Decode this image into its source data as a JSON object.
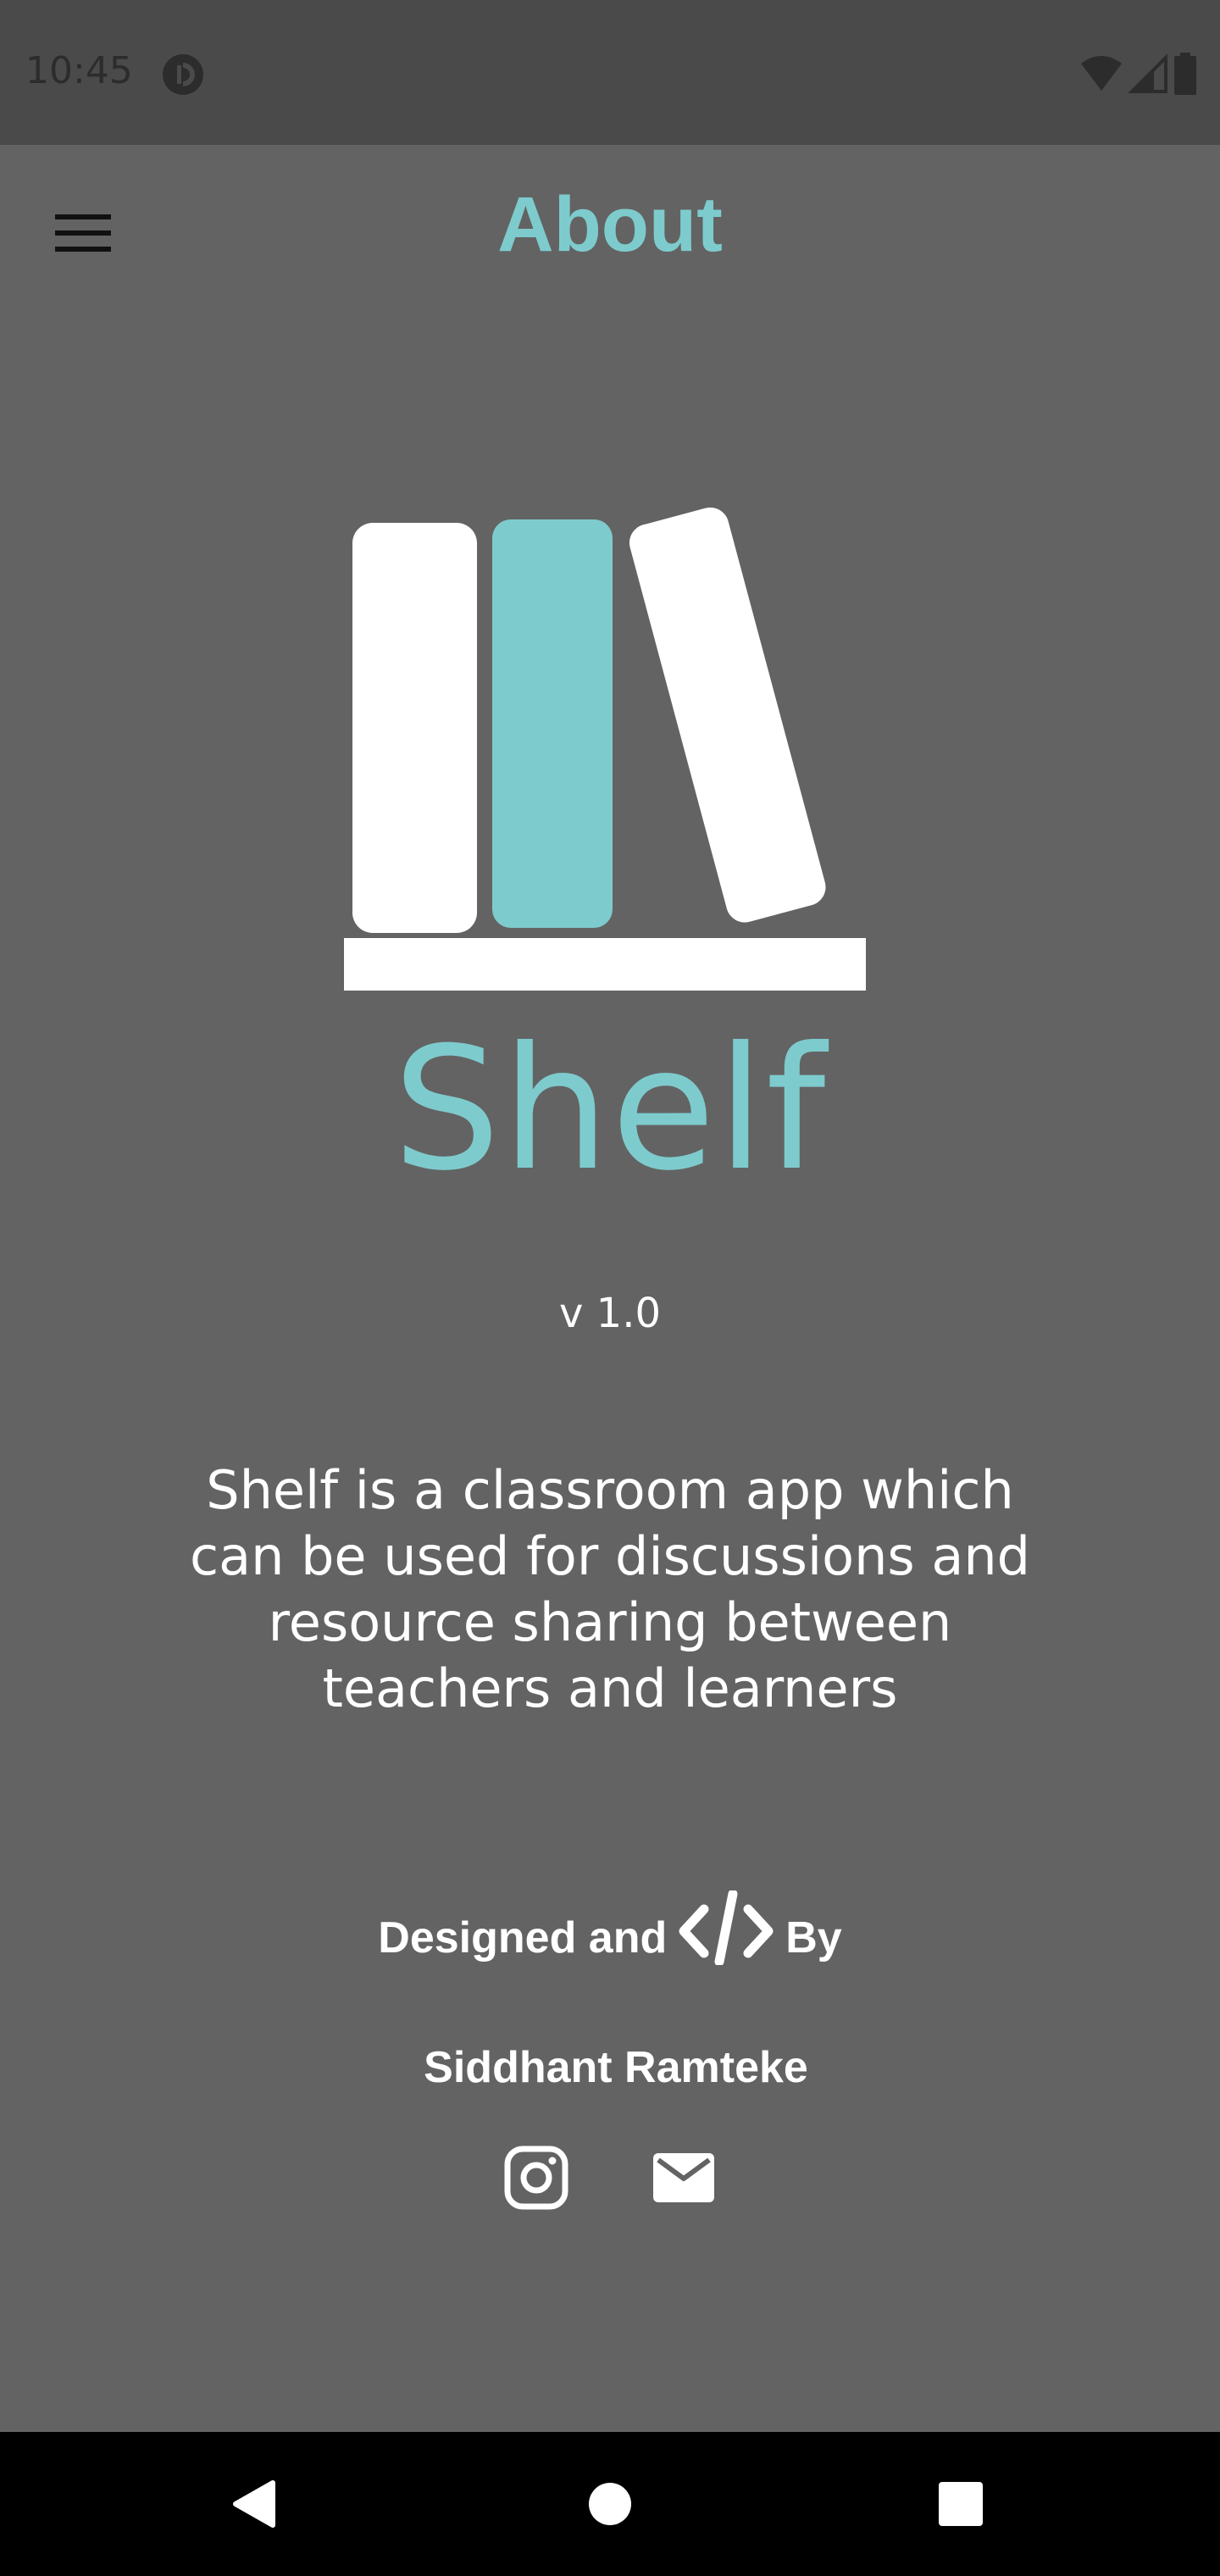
{
  "status_bar": {
    "time": "10:45",
    "app_icon": "pocket-casts-icon",
    "icons": [
      "wifi-icon",
      "signal-icon",
      "battery-icon"
    ]
  },
  "app_bar": {
    "title": "About",
    "menu_icon": "hamburger-menu-icon"
  },
  "logo": {
    "icon": "bookshelf-logo-icon",
    "app_name": "Shelf",
    "version": "v 1.0"
  },
  "description": "Shelf is a classroom app which can be used for discussions and resource sharing between teachers and learners",
  "credits": {
    "prefix": "Designed and",
    "code_icon": "code-icon",
    "suffix": "By",
    "author": "Siddhant Ramteke"
  },
  "social": [
    {
      "icon": "instagram-icon"
    },
    {
      "icon": "email-icon"
    }
  ],
  "nav_bar": {
    "buttons": [
      "back-icon",
      "home-icon",
      "recents-icon"
    ]
  },
  "colors": {
    "background": "#636363",
    "accent": "#7ecbcd",
    "text": "#ffffff",
    "status_bar": "#4a4a4a",
    "nav_bar": "#000000"
  }
}
